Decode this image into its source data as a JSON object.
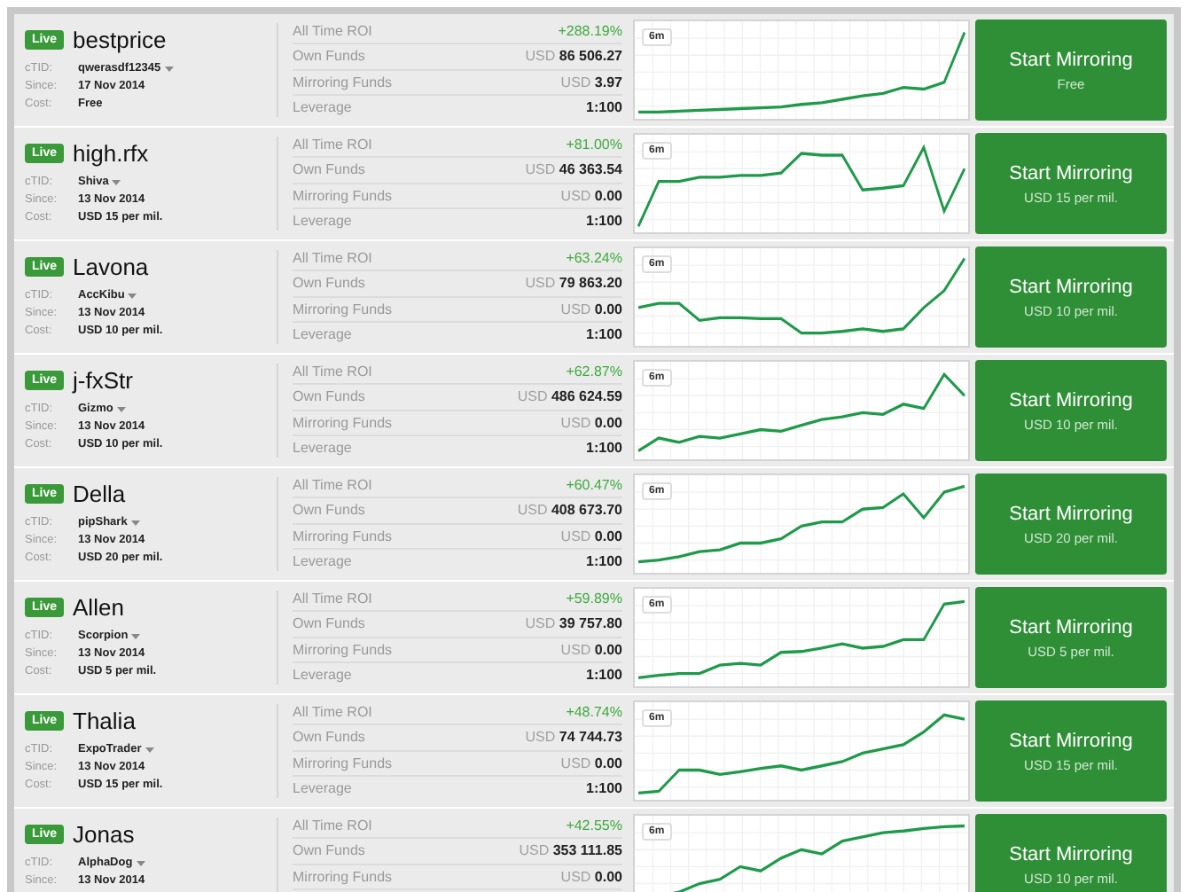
{
  "traders": [
    {
      "status": "Live",
      "name": "bestprice",
      "ctid_label": "cTID:",
      "ctid": "qwerasdf12345",
      "since_label": "Since:",
      "since": "17 Nov 2014",
      "cost_label": "Cost:",
      "cost": "Free",
      "roi_label": "All Time ROI",
      "roi": "+288.19%",
      "own_label": "Own Funds",
      "own_currency": "USD",
      "own": "86 506.27",
      "mirror_label": "Mirroring Funds",
      "mirror_currency": "USD",
      "mirror": "3.97",
      "leverage_label": "Leverage",
      "leverage": "1:100",
      "period": "6m",
      "button": "Start Mirroring",
      "button_price": "Free"
    },
    {
      "status": "Live",
      "name": "high.rfx",
      "ctid_label": "cTID:",
      "ctid": "Shiva",
      "since_label": "Since:",
      "since": "13 Nov 2014",
      "cost_label": "Cost:",
      "cost": "USD 15 per mil.",
      "roi_label": "All Time ROI",
      "roi": "+81.00%",
      "own_label": "Own Funds",
      "own_currency": "USD",
      "own": "46 363.54",
      "mirror_label": "Mirroring Funds",
      "mirror_currency": "USD",
      "mirror": "0.00",
      "leverage_label": "Leverage",
      "leverage": "1:100",
      "period": "6m",
      "button": "Start Mirroring",
      "button_price": "USD 15 per mil."
    },
    {
      "status": "Live",
      "name": "Lavona",
      "ctid_label": "cTID:",
      "ctid": "AccKibu",
      "since_label": "Since:",
      "since": "13 Nov 2014",
      "cost_label": "Cost:",
      "cost": "USD 10 per mil.",
      "roi_label": "All Time ROI",
      "roi": "+63.24%",
      "own_label": "Own Funds",
      "own_currency": "USD",
      "own": "79 863.20",
      "mirror_label": "Mirroring Funds",
      "mirror_currency": "USD",
      "mirror": "0.00",
      "leverage_label": "Leverage",
      "leverage": "1:100",
      "period": "6m",
      "button": "Start Mirroring",
      "button_price": "USD 10 per mil."
    },
    {
      "status": "Live",
      "name": "j-fxStr",
      "ctid_label": "cTID:",
      "ctid": "Gizmo",
      "since_label": "Since:",
      "since": "13 Nov 2014",
      "cost_label": "Cost:",
      "cost": "USD 10 per mil.",
      "roi_label": "All Time ROI",
      "roi": "+62.87%",
      "own_label": "Own Funds",
      "own_currency": "USD",
      "own": "486 624.59",
      "mirror_label": "Mirroring Funds",
      "mirror_currency": "USD",
      "mirror": "0.00",
      "leverage_label": "Leverage",
      "leverage": "1:100",
      "period": "6m",
      "button": "Start Mirroring",
      "button_price": "USD 10 per mil."
    },
    {
      "status": "Live",
      "name": "Della",
      "ctid_label": "cTID:",
      "ctid": "pipShark",
      "since_label": "Since:",
      "since": "13 Nov 2014",
      "cost_label": "Cost:",
      "cost": "USD 20 per mil.",
      "roi_label": "All Time ROI",
      "roi": "+60.47%",
      "own_label": "Own Funds",
      "own_currency": "USD",
      "own": "408 673.70",
      "mirror_label": "Mirroring Funds",
      "mirror_currency": "USD",
      "mirror": "0.00",
      "leverage_label": "Leverage",
      "leverage": "1:100",
      "period": "6m",
      "button": "Start Mirroring",
      "button_price": "USD 20 per mil."
    },
    {
      "status": "Live",
      "name": "Allen",
      "ctid_label": "cTID:",
      "ctid": "Scorpion",
      "since_label": "Since:",
      "since": "13 Nov 2014",
      "cost_label": "Cost:",
      "cost": "USD 5 per mil.",
      "roi_label": "All Time ROI",
      "roi": "+59.89%",
      "own_label": "Own Funds",
      "own_currency": "USD",
      "own": "39 757.80",
      "mirror_label": "Mirroring Funds",
      "mirror_currency": "USD",
      "mirror": "0.00",
      "leverage_label": "Leverage",
      "leverage": "1:100",
      "period": "6m",
      "button": "Start Mirroring",
      "button_price": "USD 5 per mil."
    },
    {
      "status": "Live",
      "name": "Thalia",
      "ctid_label": "cTID:",
      "ctid": "ExpoTrader",
      "since_label": "Since:",
      "since": "13 Nov 2014",
      "cost_label": "Cost:",
      "cost": "USD 15 per mil.",
      "roi_label": "All Time ROI",
      "roi": "+48.74%",
      "own_label": "Own Funds",
      "own_currency": "USD",
      "own": "74 744.73",
      "mirror_label": "Mirroring Funds",
      "mirror_currency": "USD",
      "mirror": "0.00",
      "leverage_label": "Leverage",
      "leverage": "1:100",
      "period": "6m",
      "button": "Start Mirroring",
      "button_price": "USD 15 per mil."
    },
    {
      "status": "Live",
      "name": "Jonas",
      "ctid_label": "cTID:",
      "ctid": "AlphaDog",
      "since_label": "Since:",
      "since": "13 Nov 2014",
      "roi_label": "All Time ROI",
      "roi": "+42.55%",
      "own_label": "Own Funds",
      "own_currency": "USD",
      "own": "353 111.85",
      "mirror_label": "Mirroring Funds",
      "mirror_currency": "USD",
      "mirror": "0.00",
      "period": "6m",
      "button": "Start Mirroring",
      "button_price": "USD 10 per mil."
    }
  ]
}
